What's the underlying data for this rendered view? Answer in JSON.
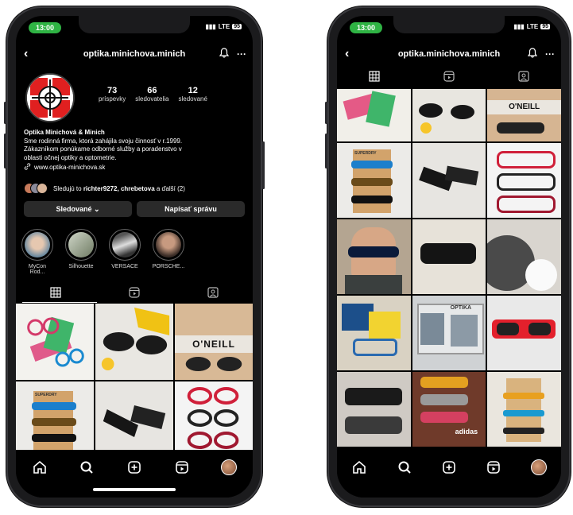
{
  "status": {
    "time": "13:00",
    "network": "LTE",
    "battery": "95"
  },
  "header": {
    "username": "optika.minichova.minich"
  },
  "profile": {
    "stats": [
      {
        "value": "73",
        "label": "príspevky"
      },
      {
        "value": "66",
        "label": "sledovatelia"
      },
      {
        "value": "12",
        "label": "sledované"
      }
    ],
    "name": "Optika Minichová & Minich",
    "bio_line1": "Sme rodinná firma, ktorá zahájila svoju činnosť v r.1999.",
    "bio_line2": "Zákazníkom ponúkame odborné služby a poradenstvo v",
    "bio_line3": "oblasti očnej optiky a optometrie.",
    "website": "www.optika-minichova.sk",
    "followed_prefix": "Sledujú to ",
    "followed_names": "richter9272, chrebetova",
    "followed_suffix": " a ďalší (2)"
  },
  "actions": {
    "following": "Sledované ⌄",
    "message": "Napísať správu"
  },
  "highlights": [
    {
      "label": "MyCon Rod..."
    },
    {
      "label": "Silhouette"
    },
    {
      "label": "VERSACE"
    },
    {
      "label": "PORSCHE..."
    }
  ],
  "grid_posts": [
    {
      "name": "post-1",
      "label": ""
    },
    {
      "name": "post-2",
      "label": ""
    },
    {
      "name": "post-3",
      "label": "O'NEILL"
    },
    {
      "name": "post-4",
      "label": "SUPERDRY"
    },
    {
      "name": "post-5",
      "label": ""
    },
    {
      "name": "post-6",
      "label": ""
    }
  ],
  "right_posts": [
    {
      "label": ""
    },
    {
      "label": ""
    },
    {
      "label": "O'NEILL"
    },
    {
      "label": "SUPERDRY"
    },
    {
      "label": ""
    },
    {
      "label": ""
    },
    {
      "label": ""
    },
    {
      "label": ""
    },
    {
      "label": ""
    },
    {
      "label": ""
    },
    {
      "label": "OPTIKA"
    },
    {
      "label": ""
    },
    {
      "label": ""
    },
    {
      "label": "adidas"
    },
    {
      "label": ""
    }
  ],
  "colors": {
    "accent_green": "#2fb344",
    "bg": "#000000",
    "button_bg": "#2a2a2a"
  }
}
